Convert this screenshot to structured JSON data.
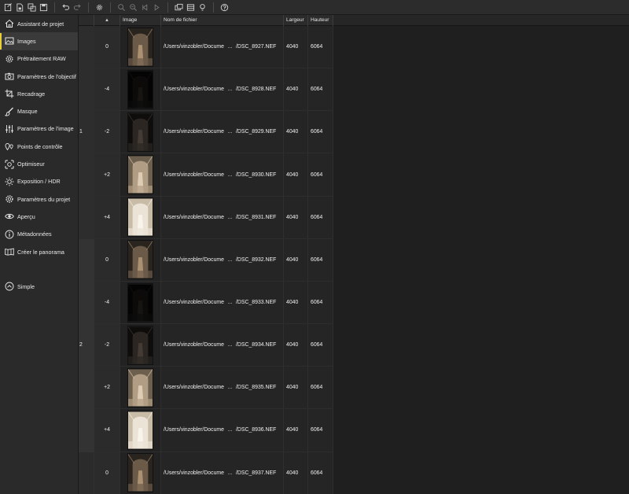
{
  "sidebar": {
    "items": [
      {
        "label": "Assistant de projet",
        "icon": "house-icon",
        "active": false
      },
      {
        "label": "Images",
        "icon": "image-icon",
        "active": true
      },
      {
        "label": "Prétraitement RAW",
        "icon": "raw-gear-icon",
        "active": false
      },
      {
        "label": "Paramètres de l'objectif",
        "icon": "camera-icon",
        "active": false
      },
      {
        "label": "Recadrage",
        "icon": "crop-icon",
        "active": false
      },
      {
        "label": "Masque",
        "icon": "brush-icon",
        "active": false
      },
      {
        "label": "Paramètres de l'image",
        "icon": "sliders-icon",
        "active": false
      },
      {
        "label": "Points de contrôle",
        "icon": "pins-icon",
        "active": false
      },
      {
        "label": "Optimiseur",
        "icon": "optimizer-icon",
        "active": false
      },
      {
        "label": "Exposition / HDR",
        "icon": "sun-icon",
        "active": false
      },
      {
        "label": "Paramètres du projet",
        "icon": "gear-icon",
        "active": false
      },
      {
        "label": "Aperçu",
        "icon": "eye-icon",
        "active": false
      },
      {
        "label": "Métadonnées",
        "icon": "info-icon",
        "active": false
      },
      {
        "label": "Créer le panorama",
        "icon": "panorama-icon",
        "active": false
      }
    ],
    "mode": {
      "label": "Simple",
      "icon": "chevron-up-circle-icon"
    }
  },
  "table": {
    "headers": {
      "sort": "▲",
      "image": "Image",
      "filename": "Nom de fichier",
      "width": "Largeur",
      "height": "Hauteur"
    },
    "groups": [
      "1",
      "2"
    ],
    "rows": [
      {
        "ev": "0",
        "path": "/Users/vinzobler/Docume",
        "ellipsis": "...",
        "file": "/DSC_8927.NEF",
        "width": "4040",
        "height": "6064",
        "tone": "mid"
      },
      {
        "ev": "-4",
        "path": "/Users/vinzobler/Docume",
        "ellipsis": "...",
        "file": "/DSC_8928.NEF",
        "width": "4040",
        "height": "6064",
        "tone": "black"
      },
      {
        "ev": "-2",
        "path": "/Users/vinzobler/Docume",
        "ellipsis": "...",
        "file": "/DSC_8929.NEF",
        "width": "4040",
        "height": "6064",
        "tone": "dark"
      },
      {
        "ev": "+2",
        "path": "/Users/vinzobler/Docume",
        "ellipsis": "...",
        "file": "/DSC_8930.NEF",
        "width": "4040",
        "height": "6064",
        "tone": "bright"
      },
      {
        "ev": "+4",
        "path": "/Users/vinzobler/Docume",
        "ellipsis": "...",
        "file": "/DSC_8931.NEF",
        "width": "4040",
        "height": "6064",
        "tone": "white"
      },
      {
        "ev": "0",
        "path": "/Users/vinzobler/Docume",
        "ellipsis": "...",
        "file": "/DSC_8932.NEF",
        "width": "4040",
        "height": "6064",
        "tone": "mid"
      },
      {
        "ev": "-4",
        "path": "/Users/vinzobler/Docume",
        "ellipsis": "...",
        "file": "/DSC_8933.NEF",
        "width": "4040",
        "height": "6064",
        "tone": "black"
      },
      {
        "ev": "-2",
        "path": "/Users/vinzobler/Docume",
        "ellipsis": "...",
        "file": "/DSC_8934.NEF",
        "width": "4040",
        "height": "6064",
        "tone": "dark"
      },
      {
        "ev": "+2",
        "path": "/Users/vinzobler/Docume",
        "ellipsis": "...",
        "file": "/DSC_8935.NEF",
        "width": "4040",
        "height": "6064",
        "tone": "bright"
      },
      {
        "ev": "+4",
        "path": "/Users/vinzobler/Docume",
        "ellipsis": "...",
        "file": "/DSC_8936.NEF",
        "width": "4040",
        "height": "6064",
        "tone": "white"
      },
      {
        "ev": "0",
        "path": "/Users/vinzobler/Docume",
        "ellipsis": "...",
        "file": "/DSC_8937.NEF",
        "width": "4040",
        "height": "6064",
        "tone": "mid"
      }
    ]
  },
  "colors": {
    "accent": "#e8cf3a",
    "panel": "#2a2a2a",
    "background": "#1f1f1f"
  }
}
